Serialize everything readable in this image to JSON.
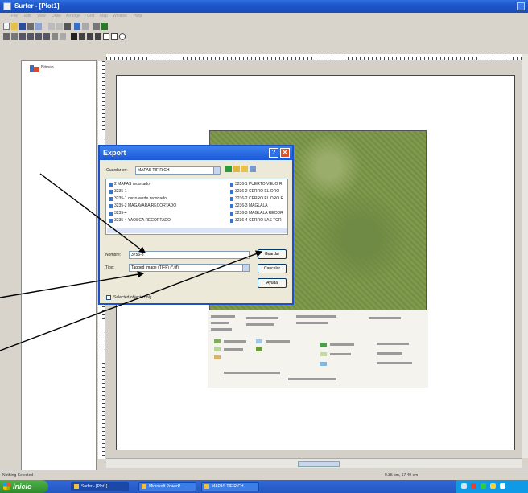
{
  "window": {
    "title": "Surfer - [Plot1]"
  },
  "menu": [
    "File",
    "Edit",
    "View",
    "Draw",
    "Arrange",
    "Grid",
    "Map",
    "Window",
    "Help"
  ],
  "object_manager": {
    "item": "Bitmap"
  },
  "dialog": {
    "title": "Export",
    "help_glyph": "?",
    "close_glyph": "✕",
    "look_in_label": "Guardar en:",
    "look_in_value": "MAPAS TIF RICH",
    "files_left": [
      "2 MAPAS recortado",
      "3235-1",
      "3235-1 cerro verde recortado",
      "3235-2 MAGAVARA RECORTADO",
      "3235-4",
      "3235-4 YAOSCA RECORTADO"
    ],
    "files_right": [
      "3236-1 PUERTO VIEJO R",
      "3236-2 CERRO EL ORO",
      "3236-2 CERRO EL ORO R",
      "3236-3 MAGLALA",
      "3236-3 MAGLALA RECOR",
      "3236-4 CERRO LAS TOR"
    ],
    "filename_label": "Nombre:",
    "filename_value": "3756-3",
    "type_label": "Tipo:",
    "type_value": "Tagged Image (TIFF) (*.tif)",
    "save_label": "Guardar",
    "cancel_label": "Cancelar",
    "help_label": "Ayuda",
    "selected_only_label": "Selected objects only"
  },
  "status": {
    "left": "Nothing Selected",
    "coords": "0.35 cm, 17.49 cm"
  },
  "taskbar": {
    "start_label": "Inicio",
    "tasks": [
      "Surfer - [Plot1]",
      "Microsoft PowerP...",
      "MAPAS TIF RICH"
    ]
  }
}
